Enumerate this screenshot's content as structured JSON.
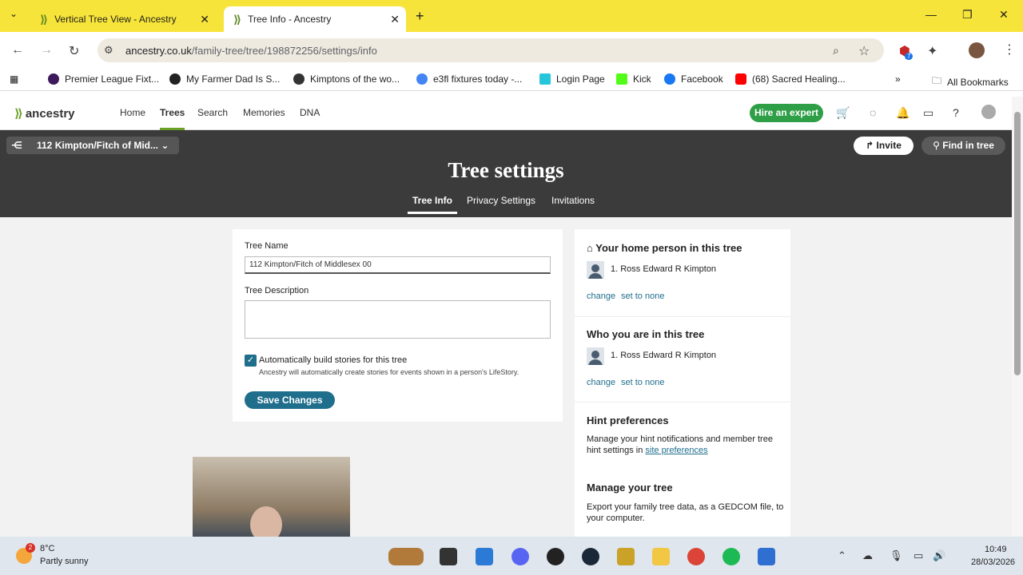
{
  "browser": {
    "tabs": [
      {
        "label": "Vertical Tree View - Ancestry"
      },
      {
        "label": "Tree Info - Ancestry"
      }
    ],
    "url_domain": "ancestry.co.uk",
    "url_path": "/family-tree/tree/198872256/settings/info",
    "extension_badge": "7"
  },
  "bookmarks": {
    "items": [
      {
        "label": "Premier League Fixt...",
        "color": "#3d195b"
      },
      {
        "label": "My Farmer Dad Is S...",
        "color": "#222222"
      },
      {
        "label": "Kimptons of the wo...",
        "color": "#333333"
      },
      {
        "label": "e3fl fixtures today -...",
        "color": "#4285f4"
      },
      {
        "label": "Login Page",
        "color": "#26c6da"
      },
      {
        "label": "Kick",
        "color": "#53fc18"
      },
      {
        "label": "Facebook",
        "color": "#1877f2"
      },
      {
        "label": "(68) Sacred Healing...",
        "color": "#ff0000"
      }
    ],
    "all_label": "All Bookmarks"
  },
  "header": {
    "logo": "ancestry",
    "nav": [
      "Home",
      "Trees",
      "Search",
      "Memories",
      "DNA"
    ],
    "hire_label": "Hire an expert"
  },
  "treebar": {
    "tree_name": "112 Kimpton/Fitch of Mid...",
    "invite_label": "Invite",
    "find_label": "Find in tree"
  },
  "settings": {
    "title": "Tree settings",
    "tabs": [
      "Tree Info",
      "Privacy Settings",
      "Invitations"
    ]
  },
  "form": {
    "name_label": "Tree Name",
    "name_value": "112 Kimpton/Fitch of Middlesex 00",
    "desc_label": "Tree Description",
    "desc_value": "",
    "auto_label": "Automatically build stories for this tree",
    "auto_help": "Ancestry will automatically create stories for events shown in a person's LifeStory.",
    "auto_checked": true,
    "save_label": "Save Changes"
  },
  "side": {
    "home_title": "Your home person in this tree",
    "home_person": "1. Ross Edward R Kimpton",
    "who_title": "Who you are in this tree",
    "who_person": "1. Ross Edward R Kimpton",
    "change_label": "change",
    "none_label": "set to none",
    "hint_title": "Hint preferences",
    "hint_text": "Manage your hint notifications and member tree hint settings in",
    "hint_link": "site preferences",
    "manage_title": "Manage your tree",
    "manage_text": "Export your family tree data, as a GEDCOM file, to your computer."
  },
  "taskbar": {
    "weather_badge": "2",
    "temp": "8°C",
    "weather": "Partly sunny",
    "time": "10:49",
    "date": "28/03/2026"
  }
}
